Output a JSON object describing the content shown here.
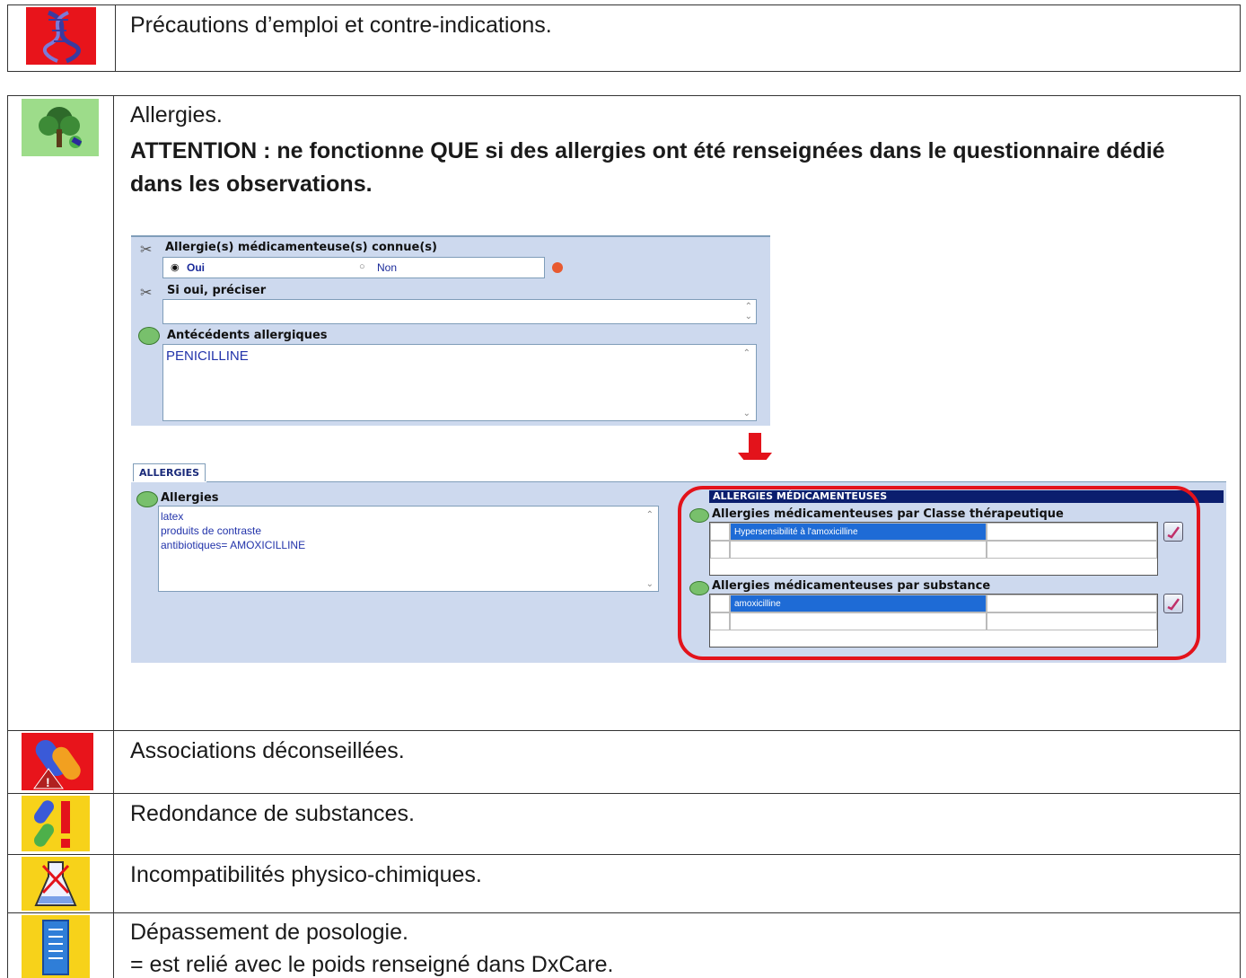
{
  "rows": [
    {
      "icon": "dna-icon",
      "text": "Précautions d’emploi et contre-indications."
    },
    {
      "icon": "allergy-tree-icon",
      "title": "Allergies.",
      "warning": "ATTENTION : ne fonctionne QUE si des allergies ont été renseignées dans le questionnaire dédié dans les observations."
    },
    {
      "icon": "pills-warning-icon",
      "text": "Associations déconseillées."
    },
    {
      "icon": "pills-exclamation-icon",
      "text": "Redondance de substances."
    },
    {
      "icon": "flask-icon",
      "text": "Incompatibilités physico-chimiques."
    },
    {
      "icon": "measure-icon",
      "text": "Dépassement de posologie.",
      "note": "= est relié avec le poids renseigné dans DxCare."
    }
  ],
  "form": {
    "q1_label": "Allergie(s) médicamenteuse(s) connue(s)",
    "opt_yes": "Oui",
    "opt_no": "Non",
    "selected": "Oui",
    "q2_label": "Si oui, préciser",
    "q3_label": "Antécédents allergiques",
    "q3_value": "PENICILLINE"
  },
  "panel": {
    "tab": "ALLERGIES",
    "allergies_label": "Allergies",
    "allergies_lines": [
      "latex",
      "produits de contraste",
      "antibiotiques= AMOXICILLINE"
    ],
    "med_header": "ALLERGIES MÉDICAMENTEUSES",
    "by_class_label": "Allergies médicamenteuses par Classe thérapeutique",
    "by_class_value": "Hypersensibilité à l'amoxicilline",
    "by_substance_label": "Allergies médicamenteuses par substance",
    "by_substance_value": "amoxicilline"
  },
  "colors": {
    "highlight_red": "#e3131b",
    "arrow_red": "#e3131b",
    "selection_blue": "#1e6bd6",
    "panel_bg": "#cdd9ee",
    "header_navy": "#0b1e6e"
  }
}
